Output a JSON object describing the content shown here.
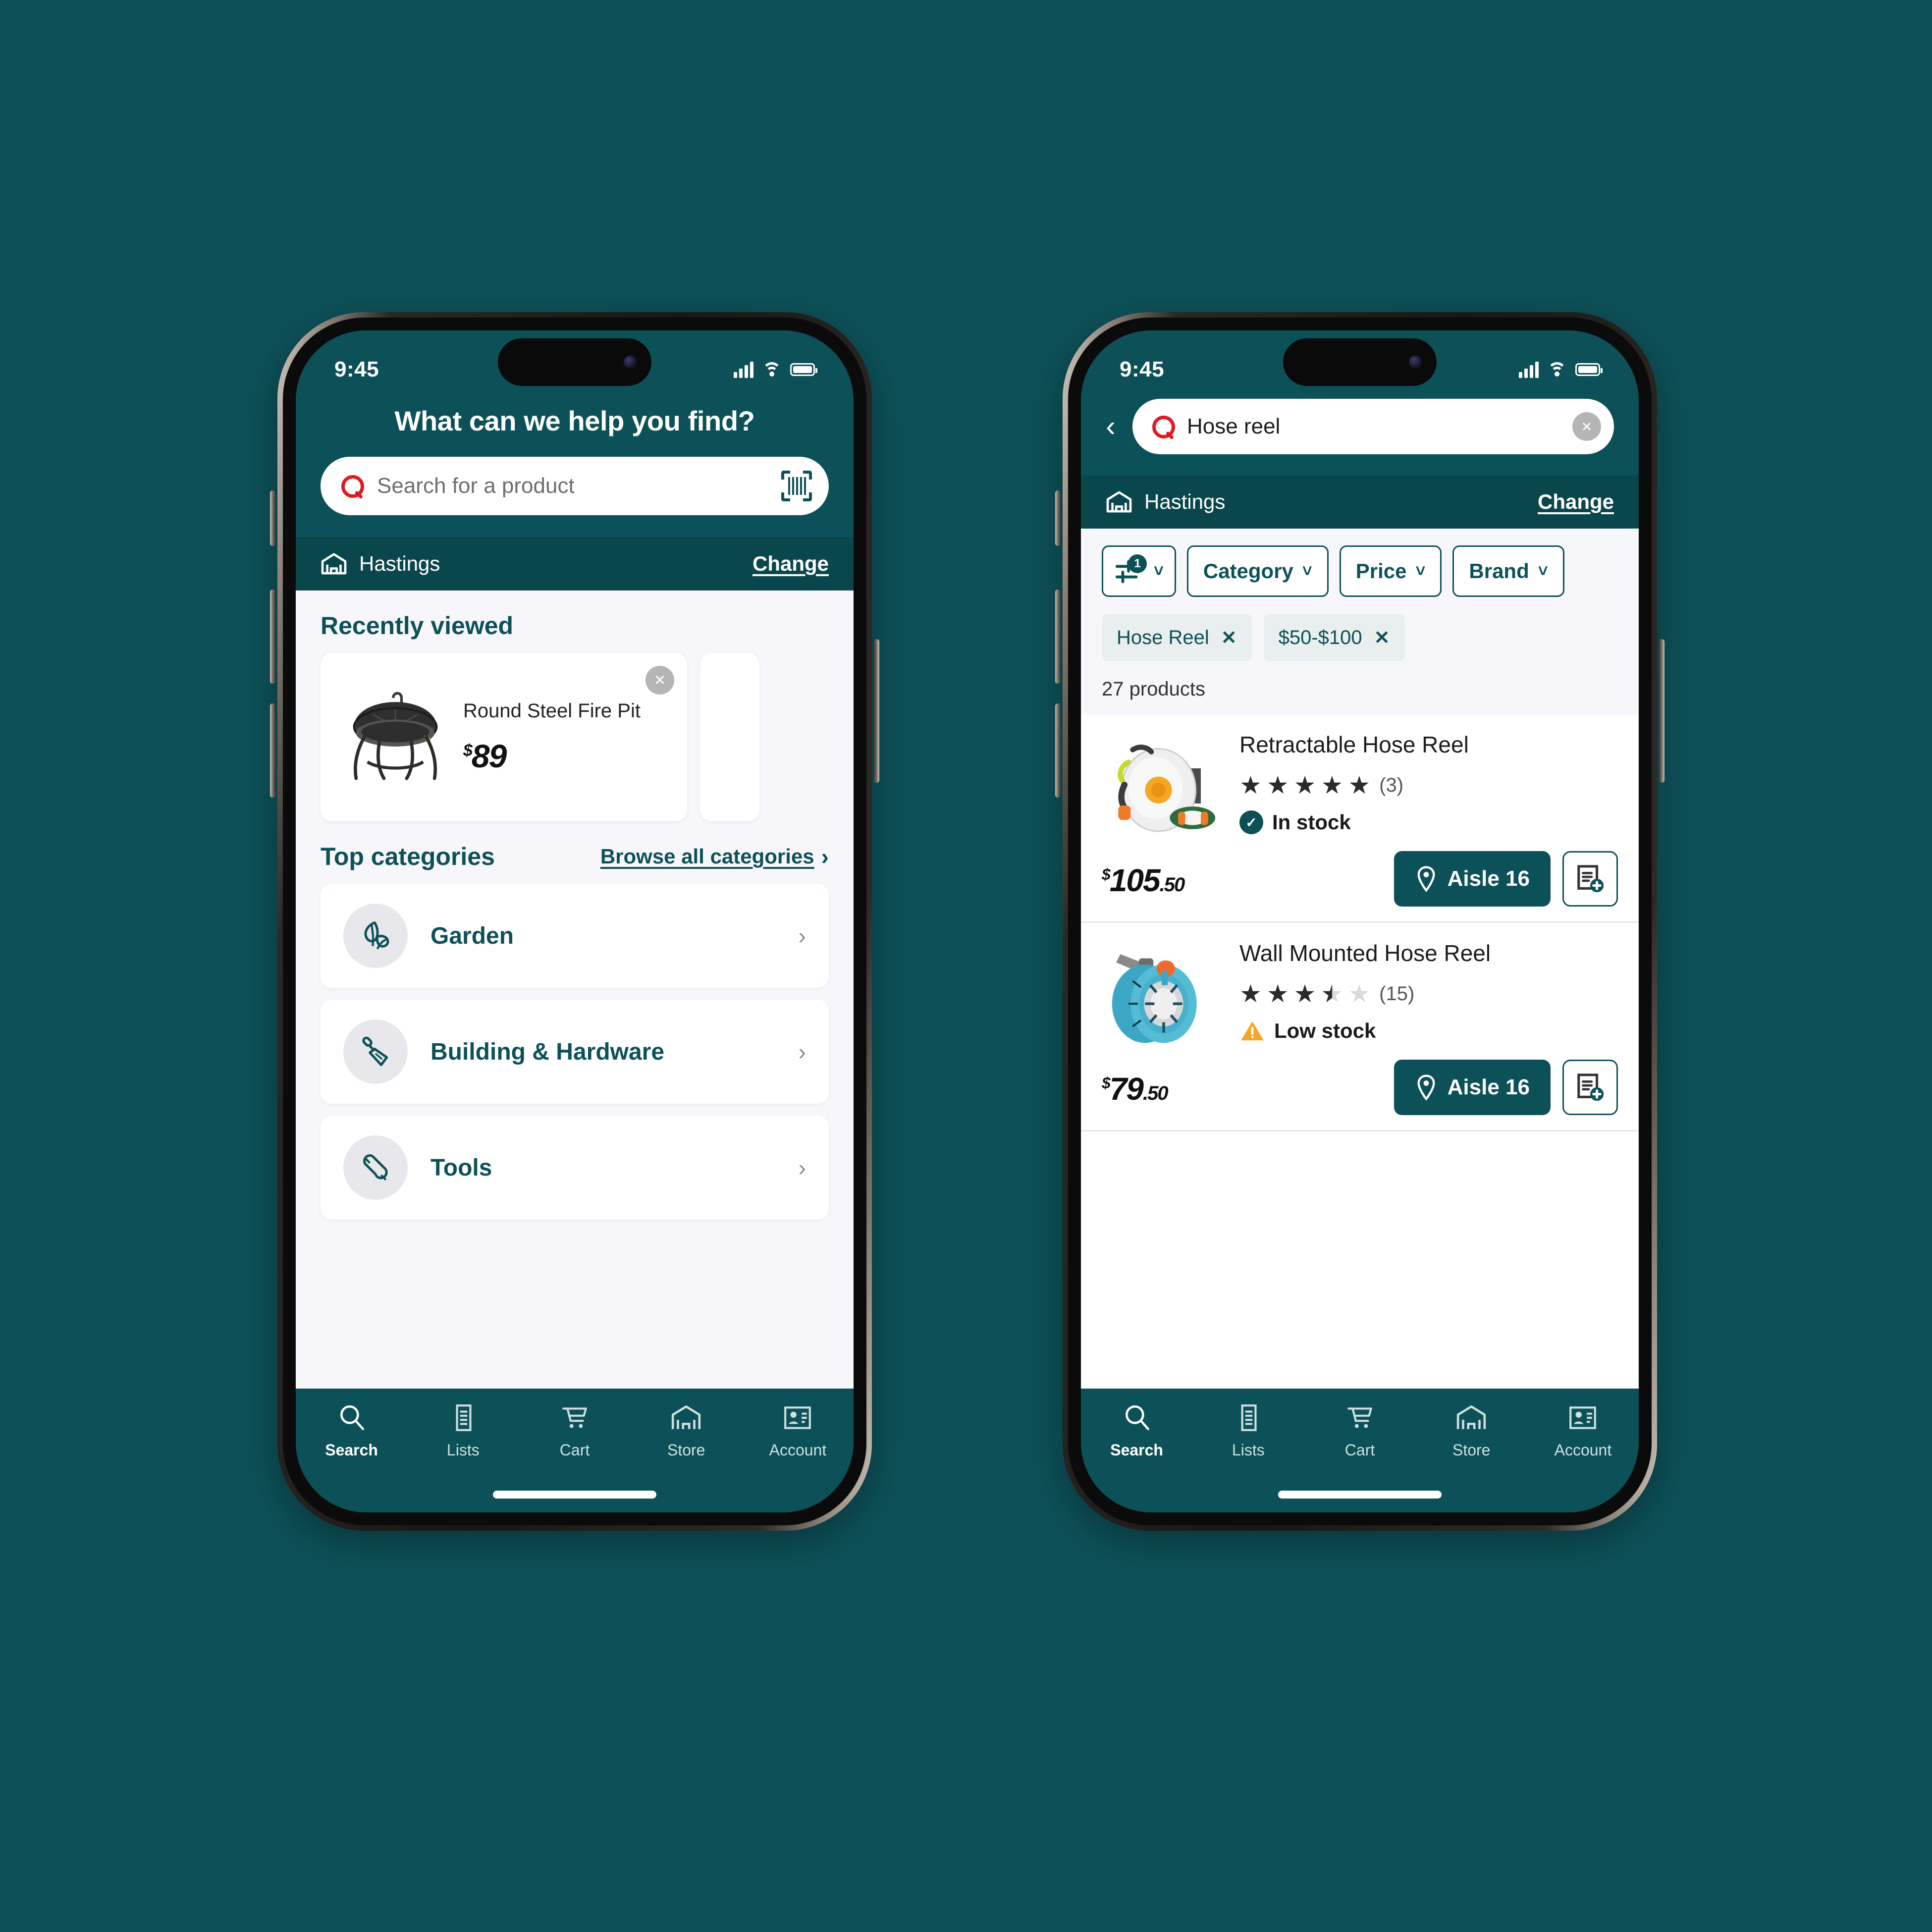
{
  "background_color": "#0d5158",
  "brand_teal": "#0d5158",
  "accent_red": "#e01a22",
  "phone1": {
    "status": {
      "time": "9:45"
    },
    "hero_title": "What can we help you find?",
    "search": {
      "placeholder": "Search for a product",
      "scan_icon": "barcode-scan-icon"
    },
    "store": {
      "name": "Hastings",
      "change_label": "Change",
      "icon": "store-icon"
    },
    "recently_viewed": {
      "title": "Recently viewed",
      "items": [
        {
          "name": "Round Steel Fire Pit",
          "currency": "$",
          "price": "89",
          "image": "fire-pit-image",
          "close_label": "×"
        }
      ]
    },
    "top_categories": {
      "title": "Top categories",
      "browse_all_label": "Browse all categories",
      "chevron": "›",
      "items": [
        {
          "label": "Garden",
          "icon": "leaf-icon"
        },
        {
          "label": "Building & Hardware",
          "icon": "trowel-icon"
        },
        {
          "label": "Tools",
          "icon": "wrench-icon"
        }
      ]
    },
    "tabs": [
      {
        "label": "Search",
        "icon": "magnifier-icon",
        "active": true
      },
      {
        "label": "Lists",
        "icon": "list-icon",
        "active": false
      },
      {
        "label": "Cart",
        "icon": "cart-icon",
        "active": false
      },
      {
        "label": "Store",
        "icon": "store-icon",
        "active": false
      },
      {
        "label": "Account",
        "icon": "account-card-icon",
        "active": false
      }
    ]
  },
  "phone2": {
    "status": {
      "time": "9:45"
    },
    "search": {
      "value": "Hose reel",
      "back_icon": "back-chevron-icon",
      "clear_label": "×"
    },
    "store": {
      "name": "Hastings",
      "change_label": "Change",
      "icon": "store-icon"
    },
    "filter_chips": [
      {
        "label": "",
        "icon": "filter-sliders-icon",
        "badge": "1",
        "caret": "⌄"
      },
      {
        "label": "Category",
        "caret": "⌄"
      },
      {
        "label": "Price",
        "caret": "⌄"
      },
      {
        "label": "Brand",
        "caret": "⌄"
      }
    ],
    "active_filters": [
      {
        "label": "Hose Reel",
        "remove": "✕"
      },
      {
        "label": "$50-$100",
        "remove": "✕"
      }
    ],
    "result_count": "27 products",
    "products": [
      {
        "name": "Retractable Hose Reel",
        "rating": 5,
        "review_count": "(3)",
        "stock_status": "In stock",
        "stock_type": "in",
        "currency": "$",
        "price_dollars": "105",
        "price_cents": ".50",
        "aisle_label": "Aisle 16",
        "image": "retractable-hose-reel-image",
        "list_icon": "add-to-list-icon"
      },
      {
        "name": "Wall Mounted Hose Reel",
        "rating": 3.5,
        "review_count": "(15)",
        "stock_status": "Low stock",
        "stock_type": "low",
        "currency": "$",
        "price_dollars": "79",
        "price_cents": ".50",
        "aisle_label": "Aisle 16",
        "image": "wall-mounted-hose-reel-image",
        "list_icon": "add-to-list-icon"
      }
    ],
    "tabs": [
      {
        "label": "Search",
        "icon": "magnifier-icon",
        "active": true
      },
      {
        "label": "Lists",
        "icon": "list-icon",
        "active": false
      },
      {
        "label": "Cart",
        "icon": "cart-icon",
        "active": false
      },
      {
        "label": "Store",
        "icon": "store-icon",
        "active": false
      },
      {
        "label": "Account",
        "icon": "account-card-icon",
        "active": false
      }
    ]
  }
}
